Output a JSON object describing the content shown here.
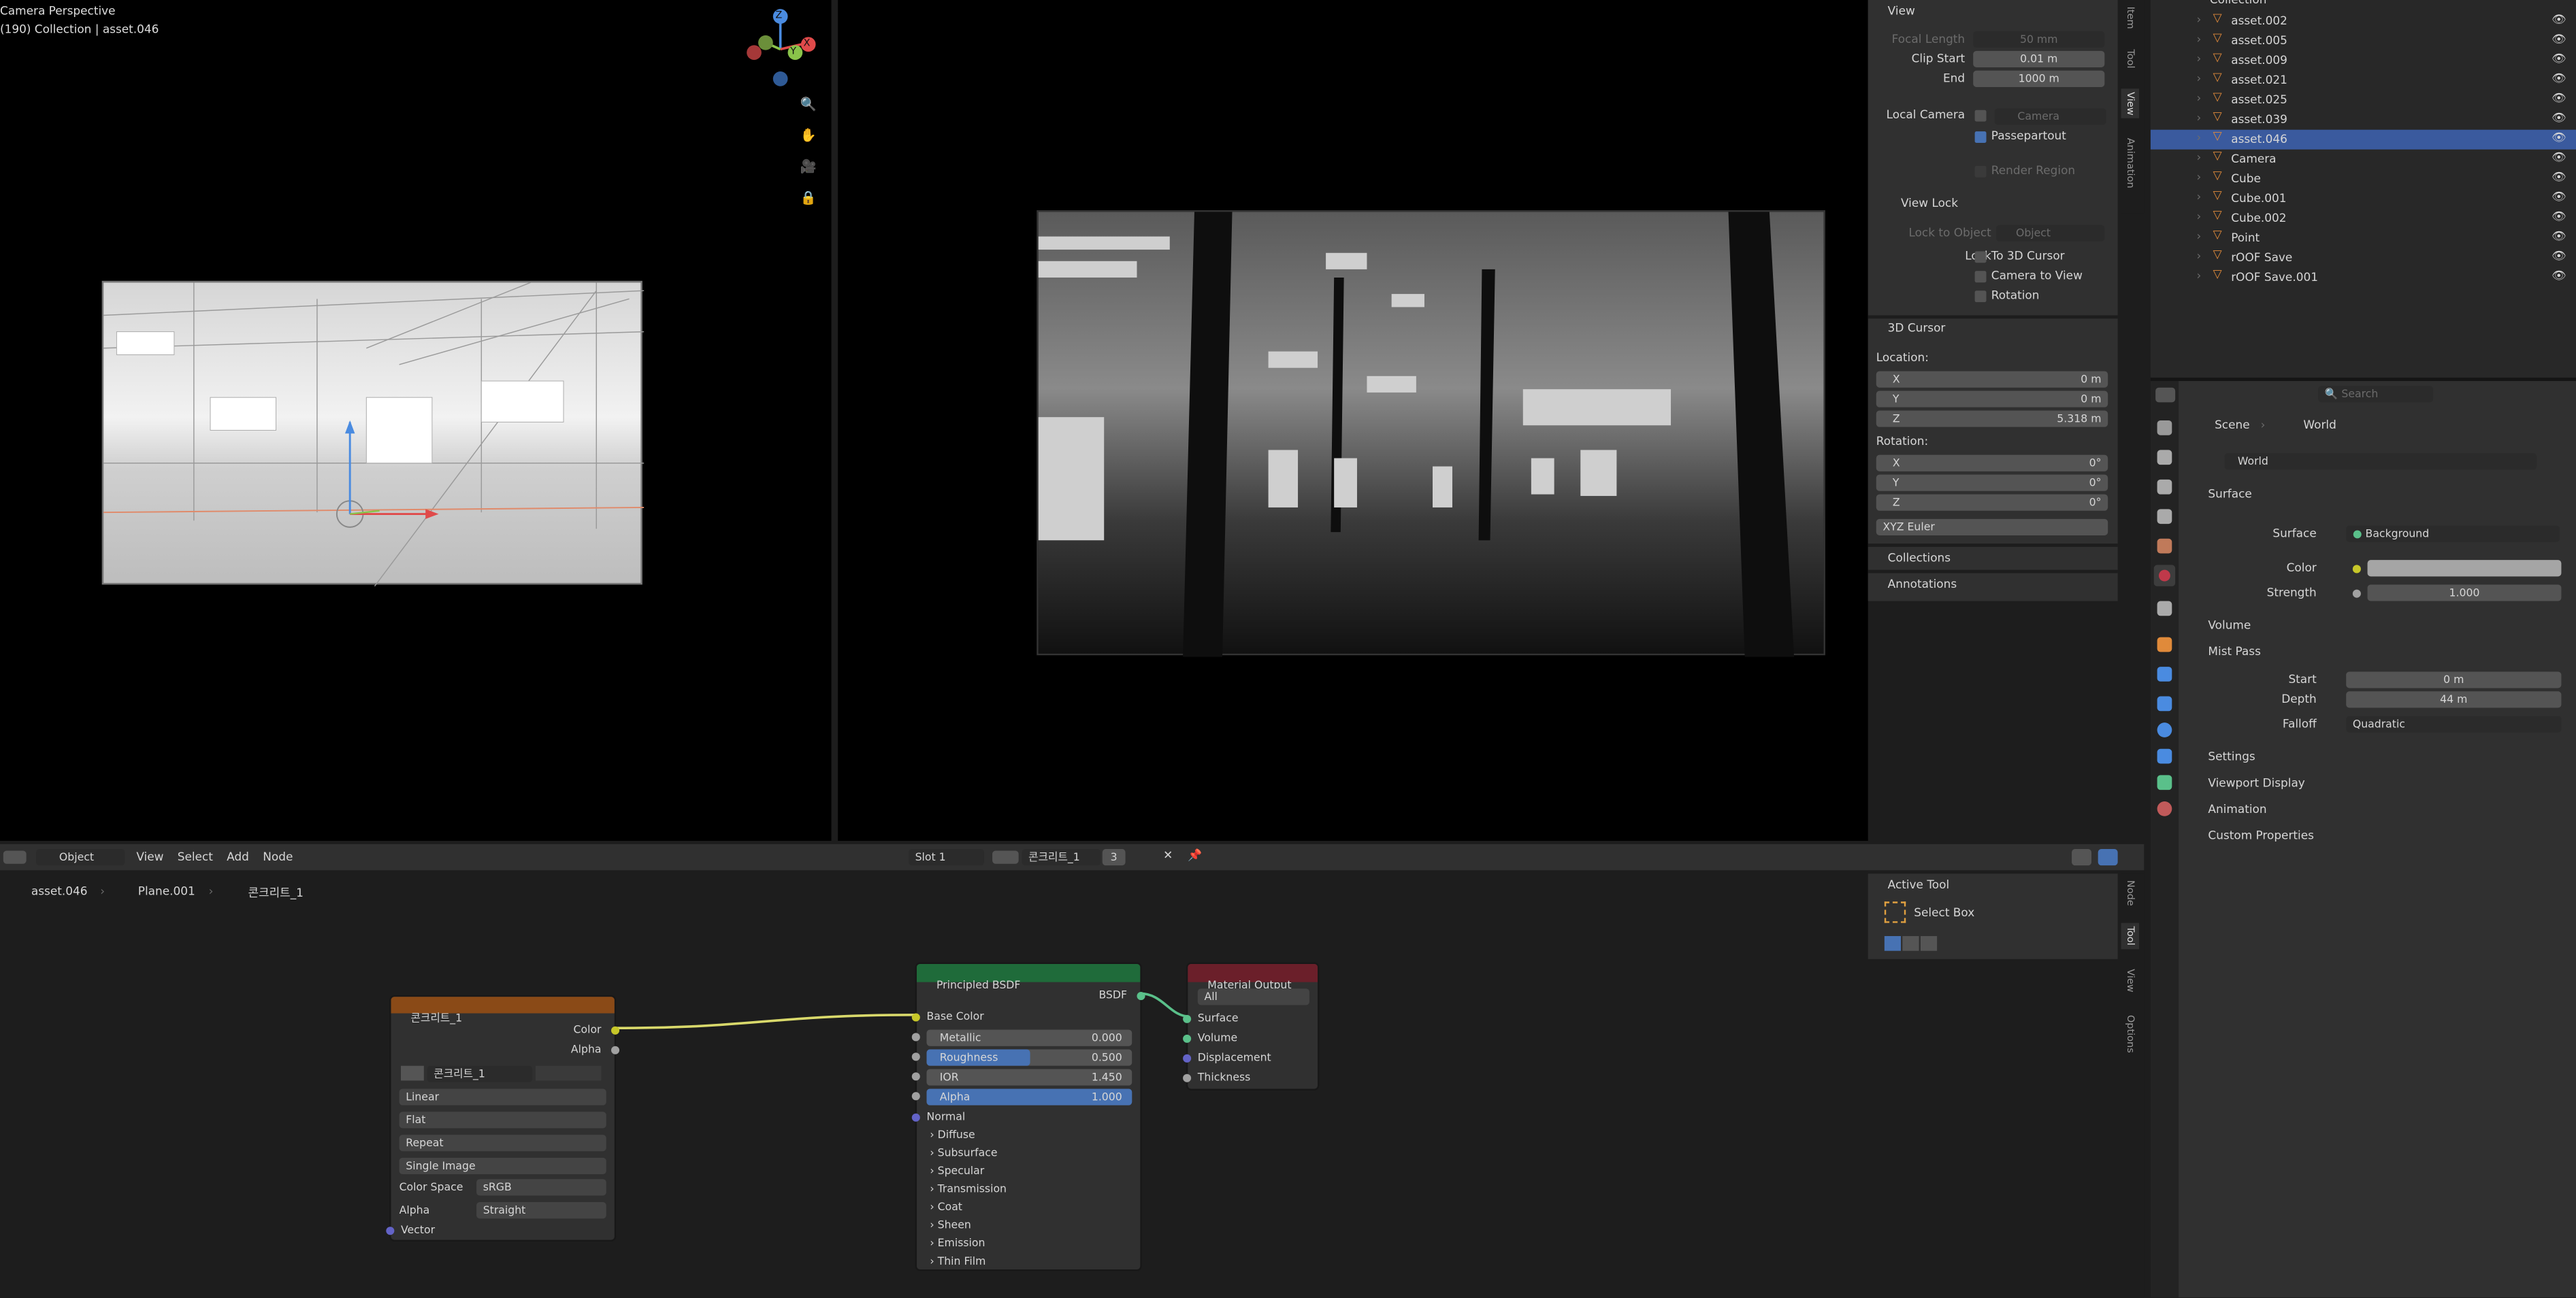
{
  "viewport_left": {
    "line1": "Camera Perspective",
    "line2": "(190) Collection | asset.046"
  },
  "gizmo": {
    "z": "Z",
    "y": "Y",
    "x": "X"
  },
  "n_panel": {
    "view_header": "View",
    "focal_length_label": "Focal Length",
    "focal_length": "50 mm",
    "clip_start_label": "Clip Start",
    "clip_start": "0.01 m",
    "end_label": "End",
    "end": "1000 m",
    "local_camera_label": "Local Camera",
    "camera": "Camera",
    "passepartout": "Passepartout",
    "render_region": "Render Region",
    "view_lock_header": "View Lock",
    "lock_to_object_label": "Lock to Object",
    "lock_object_placeholder": "Object",
    "lock_label": "Lock",
    "to_3d_cursor": "To 3D Cursor",
    "camera_to_view": "Camera to View",
    "rotation": "Rotation",
    "cursor_header": "3D Cursor",
    "location_label": "Location:",
    "loc": [
      {
        "axis": "X",
        "value": "0 m"
      },
      {
        "axis": "Y",
        "value": "0 m"
      },
      {
        "axis": "Z",
        "value": "5.318 m"
      }
    ],
    "rotation_label": "Rotation:",
    "rot": [
      {
        "axis": "X",
        "value": "0°"
      },
      {
        "axis": "Y",
        "value": "0°"
      },
      {
        "axis": "Z",
        "value": "0°"
      }
    ],
    "rot_mode": "XYZ Euler",
    "collections": "Collections",
    "annotations": "Annotations",
    "tabs": [
      "Item",
      "Tool",
      "View",
      "Animation"
    ]
  },
  "outliner": {
    "collection": "Collection",
    "items": [
      {
        "name": "asset.002"
      },
      {
        "name": "asset.005"
      },
      {
        "name": "asset.009"
      },
      {
        "name": "asset.021"
      },
      {
        "name": "asset.025"
      },
      {
        "name": "asset.039"
      },
      {
        "name": "asset.046"
      },
      {
        "name": "Camera"
      },
      {
        "name": "Cube"
      },
      {
        "name": "Cube.001"
      },
      {
        "name": "Cube.002"
      },
      {
        "name": "Point"
      },
      {
        "name": "rOOF Save"
      },
      {
        "name": "rOOF Save.001"
      }
    ]
  },
  "properties": {
    "search_placeholder": "Search",
    "breadcrumb_scene": "Scene",
    "breadcrumb_world": "World",
    "world_name": "World",
    "surface_header": "Surface",
    "surface_label": "Surface",
    "surface_value": "Background",
    "color_label": "Color",
    "strength_label": "Strength",
    "strength_value": "1.000",
    "volume_header": "Volume",
    "mist_header": "Mist Pass",
    "start_label": "Start",
    "start_value": "0 m",
    "depth_label": "Depth",
    "depth_value": "44 m",
    "falloff_label": "Falloff",
    "falloff_value": "Quadratic",
    "settings": "Settings",
    "viewport_display": "Viewport Display",
    "animation": "Animation",
    "custom_properties": "Custom Properties"
  },
  "node_editor": {
    "mode": "Object",
    "menus": [
      "View",
      "Select",
      "Add",
      "Node"
    ],
    "slot": "Slot 1",
    "material": "콘크리트_1",
    "users": "3",
    "breadcrumb": [
      "asset.046",
      "Plane.001",
      "콘크리트_1"
    ],
    "active_tool_header": "Active Tool",
    "active_tool": "Select Box",
    "side_tabs": [
      "Node",
      "Tool",
      "View",
      "Options"
    ],
    "image_node": {
      "title": "콘크리트_1",
      "color_out": "Color",
      "alpha_out": "Alpha",
      "image_name": "콘크리트_1",
      "interp": "Linear",
      "proj": "Flat",
      "ext": "Repeat",
      "source": "Single Image",
      "colorspace_label": "Color Space",
      "colorspace": "sRGB",
      "alpha_label": "Alpha",
      "alpha": "Straight",
      "vector_in": "Vector"
    },
    "bsdf_node": {
      "title": "Principled BSDF",
      "bsdf_out": "BSDF",
      "base_color": "Base Color",
      "metallic_label": "Metallic",
      "metallic": "0.000",
      "metallic_frac": 0,
      "roughness_label": "Roughness",
      "roughness": "0.500",
      "roughness_frac": 0.5,
      "ior_label": "IOR",
      "ior": "1.450",
      "alpha_label": "Alpha",
      "alpha": "1.000",
      "alpha_frac": 1,
      "normal": "Normal",
      "panels": [
        "Diffuse",
        "Subsurface",
        "Specular",
        "Transmission",
        "Coat",
        "Sheen",
        "Emission",
        "Thin Film"
      ]
    },
    "output_node": {
      "title": "Material Output",
      "target": "All",
      "inputs": [
        "Surface",
        "Volume",
        "Displacement",
        "Thickness"
      ]
    }
  },
  "colors": {
    "bsdf_header": "#1f6b3a",
    "image_header": "#8a4a17",
    "output_header": "#6b1f2a",
    "selection": "#3a5a9e",
    "accent": "#4772b3"
  }
}
